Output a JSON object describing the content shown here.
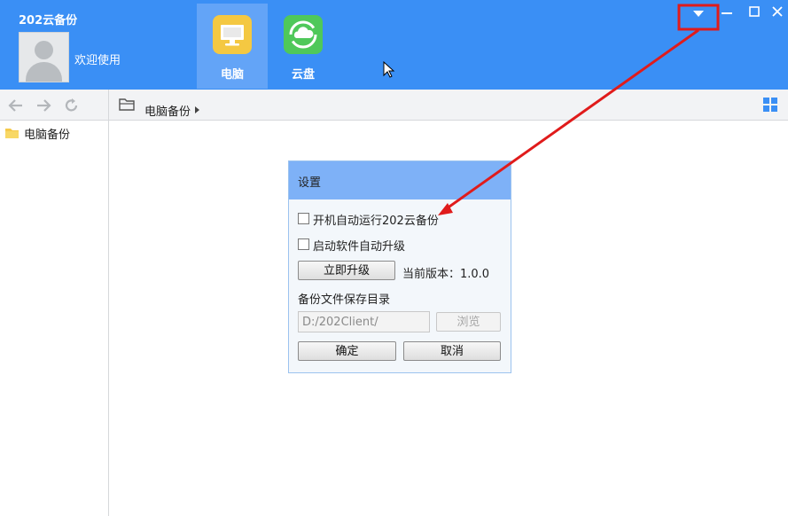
{
  "app": {
    "title": "202云备份",
    "welcome": "欢迎使用"
  },
  "nav": {
    "tabs": [
      {
        "label": "电脑",
        "icon": "monitor-icon",
        "color": "#f4c842",
        "active": true
      },
      {
        "label": "云盘",
        "icon": "cloud-icon",
        "color": "#4fc85a",
        "active": false
      }
    ]
  },
  "window_controls": [
    "menu-dropdown-icon",
    "minimize-icon",
    "maximize-icon",
    "close-icon"
  ],
  "toolbar": {
    "breadcrumb": "电脑备份"
  },
  "sidebar": {
    "items": [
      {
        "label": "电脑备份",
        "icon": "folder-icon"
      }
    ]
  },
  "settings_dialog": {
    "title": "设置",
    "autostart_label": "开机自动运行202云备份",
    "autostart_checked": false,
    "autoupgrade_label": "启动软件自动升级",
    "autoupgrade_checked": false,
    "upgrade_button": "立即升级",
    "version_text": "当前版本：1.0.0",
    "save_dir_label": "备份文件保存目录",
    "save_dir_value": "D:/202Client/",
    "browse_button": "浏览",
    "ok_button": "确定",
    "cancel_button": "取消"
  },
  "colors": {
    "header": "#3a8ff5",
    "active_tab": "#63a4f7",
    "dialog_title": "#7eb1f7",
    "annotation": "#e01b1b"
  }
}
